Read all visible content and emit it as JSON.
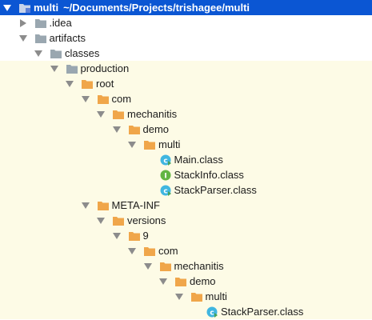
{
  "colors": {
    "selection": "#0b56d3",
    "excluded_background": "#fdfbe6",
    "folder_grey": "#9aa7b0",
    "folder_orange": "#f0a64a",
    "class_icon": "#40b6e0",
    "interface_icon": "#62b543"
  },
  "tree": [
    {
      "label": "multi",
      "path": "~/Documents/Projects/trishagee/multi",
      "depth": 0,
      "expanded": true,
      "icon": "module-folder-icon",
      "state": "selected"
    },
    {
      "label": ".idea",
      "depth": 1,
      "expanded": false,
      "icon": "folder-icon",
      "state": "normal"
    },
    {
      "label": "artifacts",
      "depth": 1,
      "expanded": true,
      "icon": "folder-icon",
      "state": "normal"
    },
    {
      "label": "classes",
      "depth": 2,
      "expanded": true,
      "icon": "folder-icon",
      "state": "normal"
    },
    {
      "label": "production",
      "depth": 3,
      "expanded": true,
      "icon": "folder-icon",
      "state": "excluded"
    },
    {
      "label": "root",
      "depth": 4,
      "expanded": true,
      "icon": "orange-folder-icon",
      "state": "excluded"
    },
    {
      "label": "com",
      "depth": 5,
      "expanded": true,
      "icon": "orange-folder-icon",
      "state": "excluded"
    },
    {
      "label": "mechanitis",
      "depth": 6,
      "expanded": true,
      "icon": "orange-folder-icon",
      "state": "excluded"
    },
    {
      "label": "demo",
      "depth": 7,
      "expanded": true,
      "icon": "orange-folder-icon",
      "state": "excluded"
    },
    {
      "label": "multi",
      "depth": 8,
      "expanded": true,
      "icon": "orange-folder-icon",
      "state": "excluded"
    },
    {
      "label": "Main.class",
      "depth": 9,
      "icon": "class-icon",
      "state": "excluded"
    },
    {
      "label": "StackInfo.class",
      "depth": 9,
      "icon": "interface-icon",
      "state": "excluded"
    },
    {
      "label": "StackParser.class",
      "depth": 9,
      "icon": "class-icon",
      "state": "excluded"
    },
    {
      "label": "META-INF",
      "depth": 5,
      "expanded": true,
      "icon": "orange-folder-icon",
      "state": "excluded"
    },
    {
      "label": "versions",
      "depth": 6,
      "expanded": true,
      "icon": "orange-folder-icon",
      "state": "excluded"
    },
    {
      "label": "9",
      "depth": 7,
      "expanded": true,
      "icon": "orange-folder-icon",
      "state": "excluded"
    },
    {
      "label": "com",
      "depth": 8,
      "expanded": true,
      "icon": "orange-folder-icon",
      "state": "excluded"
    },
    {
      "label": "mechanitis",
      "depth": 9,
      "expanded": true,
      "icon": "orange-folder-icon",
      "state": "excluded"
    },
    {
      "label": "demo",
      "depth": 10,
      "expanded": true,
      "icon": "orange-folder-icon",
      "state": "excluded"
    },
    {
      "label": "multi",
      "depth": 11,
      "expanded": true,
      "icon": "orange-folder-icon",
      "state": "excluded"
    },
    {
      "label": "StackParser.class",
      "depth": 12,
      "icon": "class-icon",
      "state": "excluded"
    }
  ]
}
